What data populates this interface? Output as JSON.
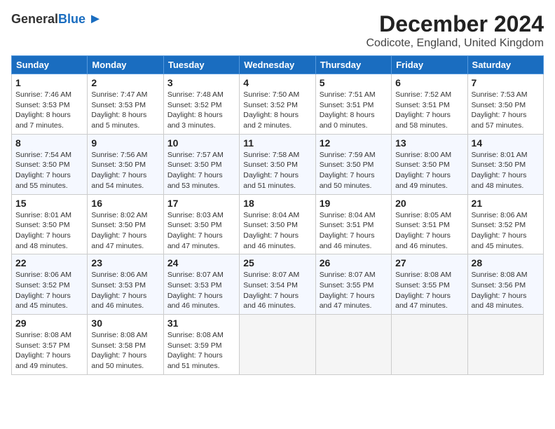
{
  "header": {
    "logo_general": "General",
    "logo_blue": "Blue",
    "month_title": "December 2024",
    "subtitle": "Codicote, England, United Kingdom"
  },
  "calendar": {
    "days_of_week": [
      "Sunday",
      "Monday",
      "Tuesday",
      "Wednesday",
      "Thursday",
      "Friday",
      "Saturday"
    ],
    "weeks": [
      [
        {
          "day": "1",
          "sunrise": "Sunrise: 7:46 AM",
          "sunset": "Sunset: 3:53 PM",
          "daylight": "Daylight: 8 hours and 7 minutes."
        },
        {
          "day": "2",
          "sunrise": "Sunrise: 7:47 AM",
          "sunset": "Sunset: 3:53 PM",
          "daylight": "Daylight: 8 hours and 5 minutes."
        },
        {
          "day": "3",
          "sunrise": "Sunrise: 7:48 AM",
          "sunset": "Sunset: 3:52 PM",
          "daylight": "Daylight: 8 hours and 3 minutes."
        },
        {
          "day": "4",
          "sunrise": "Sunrise: 7:50 AM",
          "sunset": "Sunset: 3:52 PM",
          "daylight": "Daylight: 8 hours and 2 minutes."
        },
        {
          "day": "5",
          "sunrise": "Sunrise: 7:51 AM",
          "sunset": "Sunset: 3:51 PM",
          "daylight": "Daylight: 8 hours and 0 minutes."
        },
        {
          "day": "6",
          "sunrise": "Sunrise: 7:52 AM",
          "sunset": "Sunset: 3:51 PM",
          "daylight": "Daylight: 7 hours and 58 minutes."
        },
        {
          "day": "7",
          "sunrise": "Sunrise: 7:53 AM",
          "sunset": "Sunset: 3:50 PM",
          "daylight": "Daylight: 7 hours and 57 minutes."
        }
      ],
      [
        {
          "day": "8",
          "sunrise": "Sunrise: 7:54 AM",
          "sunset": "Sunset: 3:50 PM",
          "daylight": "Daylight: 7 hours and 55 minutes."
        },
        {
          "day": "9",
          "sunrise": "Sunrise: 7:56 AM",
          "sunset": "Sunset: 3:50 PM",
          "daylight": "Daylight: 7 hours and 54 minutes."
        },
        {
          "day": "10",
          "sunrise": "Sunrise: 7:57 AM",
          "sunset": "Sunset: 3:50 PM",
          "daylight": "Daylight: 7 hours and 53 minutes."
        },
        {
          "day": "11",
          "sunrise": "Sunrise: 7:58 AM",
          "sunset": "Sunset: 3:50 PM",
          "daylight": "Daylight: 7 hours and 51 minutes."
        },
        {
          "day": "12",
          "sunrise": "Sunrise: 7:59 AM",
          "sunset": "Sunset: 3:50 PM",
          "daylight": "Daylight: 7 hours and 50 minutes."
        },
        {
          "day": "13",
          "sunrise": "Sunrise: 8:00 AM",
          "sunset": "Sunset: 3:50 PM",
          "daylight": "Daylight: 7 hours and 49 minutes."
        },
        {
          "day": "14",
          "sunrise": "Sunrise: 8:01 AM",
          "sunset": "Sunset: 3:50 PM",
          "daylight": "Daylight: 7 hours and 48 minutes."
        }
      ],
      [
        {
          "day": "15",
          "sunrise": "Sunrise: 8:01 AM",
          "sunset": "Sunset: 3:50 PM",
          "daylight": "Daylight: 7 hours and 48 minutes."
        },
        {
          "day": "16",
          "sunrise": "Sunrise: 8:02 AM",
          "sunset": "Sunset: 3:50 PM",
          "daylight": "Daylight: 7 hours and 47 minutes."
        },
        {
          "day": "17",
          "sunrise": "Sunrise: 8:03 AM",
          "sunset": "Sunset: 3:50 PM",
          "daylight": "Daylight: 7 hours and 47 minutes."
        },
        {
          "day": "18",
          "sunrise": "Sunrise: 8:04 AM",
          "sunset": "Sunset: 3:50 PM",
          "daylight": "Daylight: 7 hours and 46 minutes."
        },
        {
          "day": "19",
          "sunrise": "Sunrise: 8:04 AM",
          "sunset": "Sunset: 3:51 PM",
          "daylight": "Daylight: 7 hours and 46 minutes."
        },
        {
          "day": "20",
          "sunrise": "Sunrise: 8:05 AM",
          "sunset": "Sunset: 3:51 PM",
          "daylight": "Daylight: 7 hours and 46 minutes."
        },
        {
          "day": "21",
          "sunrise": "Sunrise: 8:06 AM",
          "sunset": "Sunset: 3:52 PM",
          "daylight": "Daylight: 7 hours and 45 minutes."
        }
      ],
      [
        {
          "day": "22",
          "sunrise": "Sunrise: 8:06 AM",
          "sunset": "Sunset: 3:52 PM",
          "daylight": "Daylight: 7 hours and 45 minutes."
        },
        {
          "day": "23",
          "sunrise": "Sunrise: 8:06 AM",
          "sunset": "Sunset: 3:53 PM",
          "daylight": "Daylight: 7 hours and 46 minutes."
        },
        {
          "day": "24",
          "sunrise": "Sunrise: 8:07 AM",
          "sunset": "Sunset: 3:53 PM",
          "daylight": "Daylight: 7 hours and 46 minutes."
        },
        {
          "day": "25",
          "sunrise": "Sunrise: 8:07 AM",
          "sunset": "Sunset: 3:54 PM",
          "daylight": "Daylight: 7 hours and 46 minutes."
        },
        {
          "day": "26",
          "sunrise": "Sunrise: 8:07 AM",
          "sunset": "Sunset: 3:55 PM",
          "daylight": "Daylight: 7 hours and 47 minutes."
        },
        {
          "day": "27",
          "sunrise": "Sunrise: 8:08 AM",
          "sunset": "Sunset: 3:55 PM",
          "daylight": "Daylight: 7 hours and 47 minutes."
        },
        {
          "day": "28",
          "sunrise": "Sunrise: 8:08 AM",
          "sunset": "Sunset: 3:56 PM",
          "daylight": "Daylight: 7 hours and 48 minutes."
        }
      ],
      [
        {
          "day": "29",
          "sunrise": "Sunrise: 8:08 AM",
          "sunset": "Sunset: 3:57 PM",
          "daylight": "Daylight: 7 hours and 49 minutes."
        },
        {
          "day": "30",
          "sunrise": "Sunrise: 8:08 AM",
          "sunset": "Sunset: 3:58 PM",
          "daylight": "Daylight: 7 hours and 50 minutes."
        },
        {
          "day": "31",
          "sunrise": "Sunrise: 8:08 AM",
          "sunset": "Sunset: 3:59 PM",
          "daylight": "Daylight: 7 hours and 51 minutes."
        },
        null,
        null,
        null,
        null
      ]
    ]
  }
}
